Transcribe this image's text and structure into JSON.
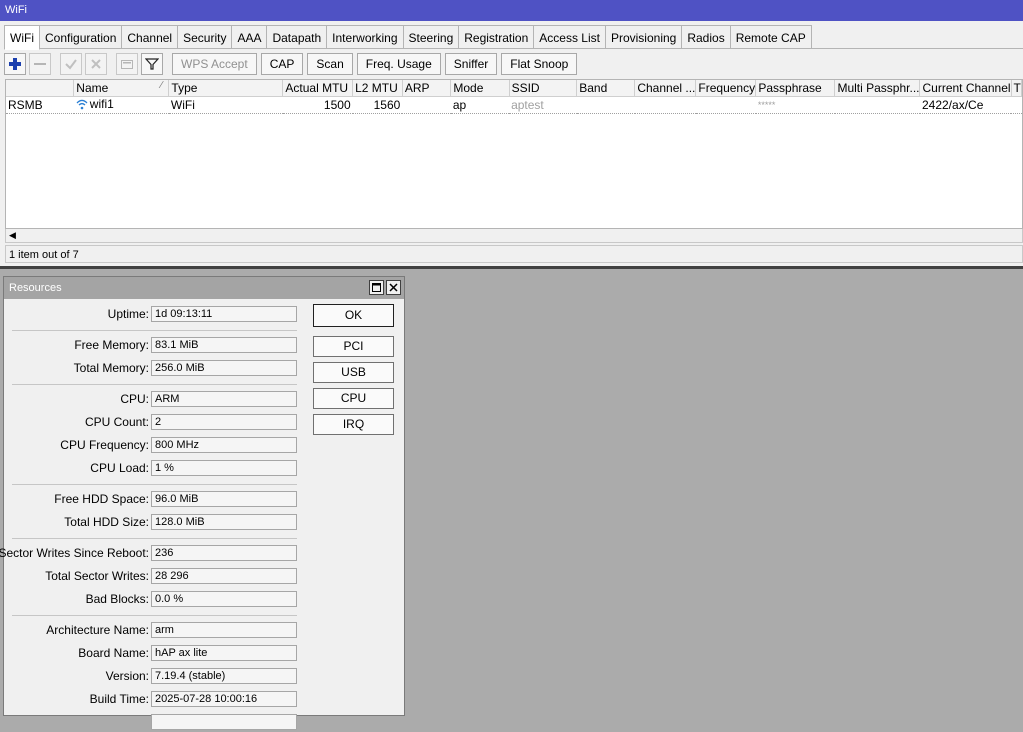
{
  "wifi_window": {
    "title": "WiFi",
    "tabs": [
      "WiFi",
      "Configuration",
      "Channel",
      "Security",
      "AAA",
      "Datapath",
      "Interworking",
      "Steering",
      "Registration",
      "Access List",
      "Provisioning",
      "Radios",
      "Remote CAP"
    ],
    "toolbar": {
      "icons": [
        "add-icon",
        "remove-icon",
        "enable-icon",
        "disable-icon",
        "comment-icon",
        "filter-icon"
      ],
      "buttons": [
        "WPS Accept",
        "CAP",
        "Scan",
        "Freq. Usage",
        "Sniffer",
        "Flat Snoop"
      ]
    },
    "table": {
      "columns": [
        "",
        "Name",
        "Type",
        "Actual MTU",
        "L2 MTU",
        "ARP",
        "Mode",
        "SSID",
        "Band",
        "Channel ...",
        "Frequency",
        "Passphrase",
        "Multi Passphr...",
        "Current Channel",
        "T"
      ],
      "rows": [
        {
          "flag": "RSMB",
          "name": "wifi1",
          "type": "WiFi",
          "actual_mtu": "1500",
          "l2_mtu": "1560",
          "arp": "",
          "mode": "ap",
          "ssid": "aptest",
          "band": "",
          "channel": "",
          "frequency": "",
          "passphrase": "*****",
          "multi_passphrase": "",
          "current_channel": "2422/ax/Ce",
          "t": ""
        }
      ]
    },
    "status": "1 item out of 7"
  },
  "resources_window": {
    "title": "Resources",
    "fields": [
      {
        "label": "Uptime:",
        "value": "1d 09:13:11"
      },
      {
        "label": "Free Memory:",
        "value": "83.1 MiB"
      },
      {
        "label": "Total Memory:",
        "value": "256.0 MiB"
      },
      {
        "label": "CPU:",
        "value": "ARM"
      },
      {
        "label": "CPU Count:",
        "value": "2"
      },
      {
        "label": "CPU Frequency:",
        "value": "800 MHz"
      },
      {
        "label": "CPU Load:",
        "value": "1 %"
      },
      {
        "label": "Free HDD Space:",
        "value": "96.0 MiB"
      },
      {
        "label": "Total HDD Size:",
        "value": "128.0 MiB"
      },
      {
        "label": "Sector Writes Since Reboot:",
        "value": "236"
      },
      {
        "label": "Total Sector Writes:",
        "value": "28 296"
      },
      {
        "label": "Bad Blocks:",
        "value": "0.0 %"
      },
      {
        "label": "Architecture Name:",
        "value": "arm"
      },
      {
        "label": "Board Name:",
        "value": "hAP ax lite"
      },
      {
        "label": "Version:",
        "value": "7.19.4 (stable)"
      },
      {
        "label": "Build Time:",
        "value": "2025-07-28 10:00:16"
      },
      {
        "label": "",
        "value": ""
      }
    ],
    "buttons": [
      "OK",
      "PCI",
      "USB",
      "CPU",
      "IRQ"
    ]
  },
  "colors": {
    "titlebar_active": "#4f52c4",
    "titlebar_inactive": "#a4a4a4",
    "desktop": "#ababab",
    "wifi_icon": "#2a7fd4",
    "add_icon": "#1b3fae"
  }
}
